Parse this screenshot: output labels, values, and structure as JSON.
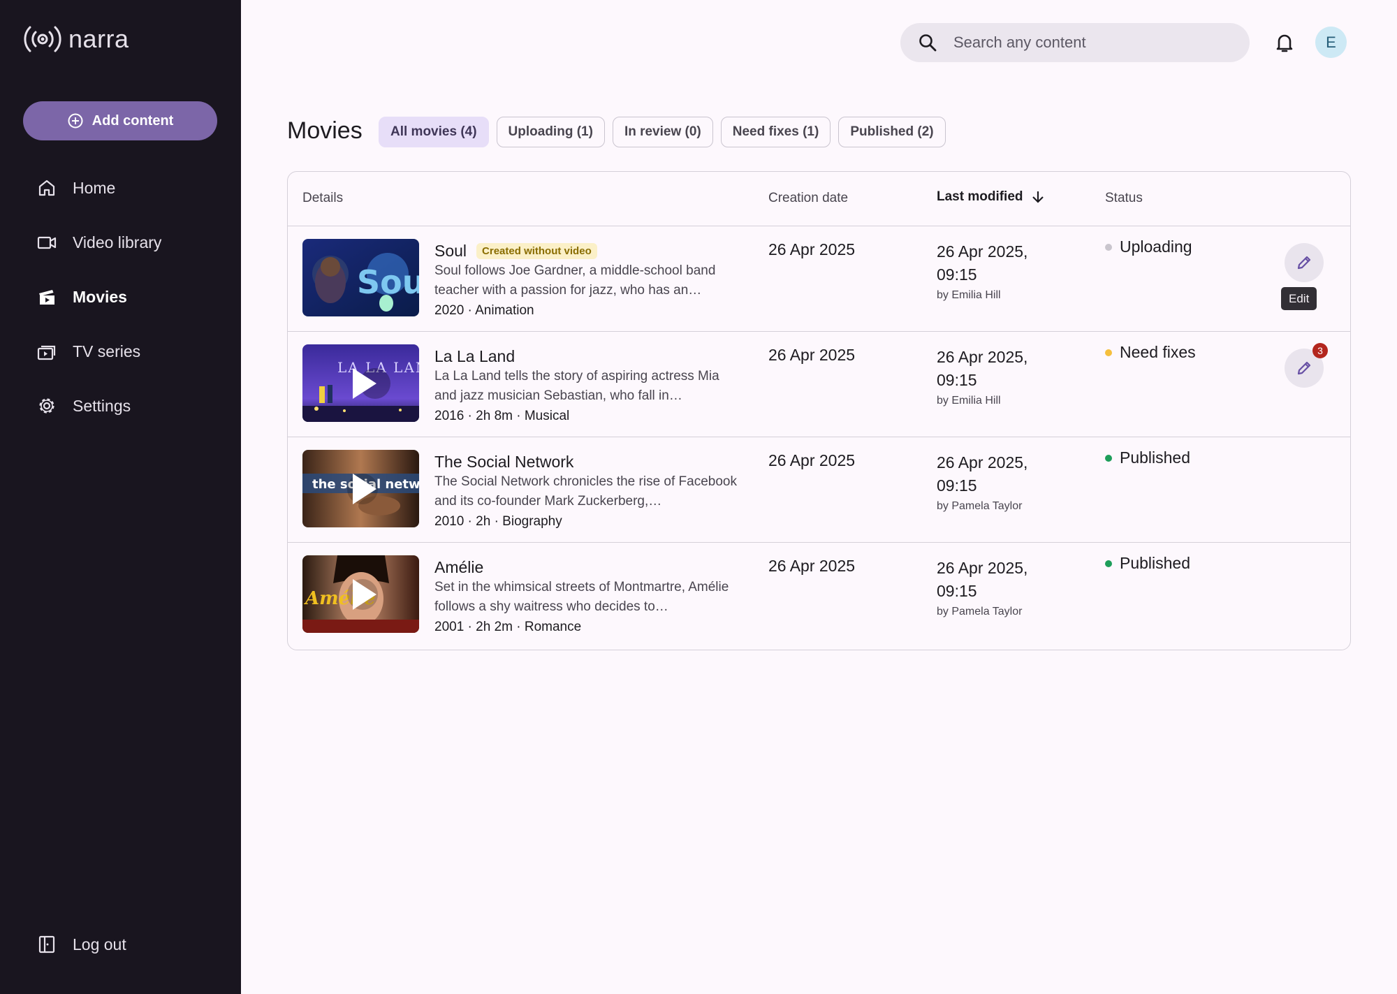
{
  "app": {
    "name": "narra"
  },
  "sidebar": {
    "add_button": "Add content",
    "items": [
      {
        "label": "Home",
        "icon": "home-icon"
      },
      {
        "label": "Video library",
        "icon": "video-camera-icon"
      },
      {
        "label": "Movies",
        "icon": "movie-clapper-icon",
        "active": true
      },
      {
        "label": "TV series",
        "icon": "tv-series-icon"
      },
      {
        "label": "Settings",
        "icon": "gear-icon"
      }
    ],
    "logout": "Log out"
  },
  "header": {
    "search_placeholder": "Search any content",
    "avatar_initial": "E"
  },
  "page": {
    "title": "Movies",
    "filters": [
      {
        "label": "All movies (4)",
        "active": true
      },
      {
        "label": "Uploading (1)"
      },
      {
        "label": "In review (0)"
      },
      {
        "label": "Need fixes (1)"
      },
      {
        "label": "Published (2)"
      }
    ]
  },
  "table": {
    "columns": {
      "details": "Details",
      "creation_date": "Creation date",
      "last_modified": "Last modified",
      "status": "Status"
    },
    "rows": [
      {
        "title": "Soul",
        "tag": "Created without video",
        "description": "Soul follows Joe Gardner, a middle-school band teacher with a passion for jazz, who has an…",
        "meta": "2020 · Animation",
        "creation_date": "26 Apr 2025",
        "modified_date": "26 Apr 2025,",
        "modified_time": "09:15",
        "modified_by": "by Emilia Hill",
        "status": "Uploading",
        "status_color": "#c9c5cd",
        "edit_tooltip": "Edit"
      },
      {
        "title": "La La Land",
        "description": "La La Land tells the story of aspiring actress Mia and jazz musician Sebastian, who fall in…",
        "meta": "2016 · 2h 8m · Musical",
        "creation_date": "26 Apr 2025",
        "modified_date": "26 Apr 2025,",
        "modified_time": "09:15",
        "modified_by": "by Emilia Hill",
        "status": "Need fixes",
        "status_color": "#f5bf3d",
        "edit_badge": "3"
      },
      {
        "title": "The Social Network",
        "description": "The Social Network chronicles the rise of Facebook and its co-founder Mark Zuckerberg,…",
        "meta": "2010 · 2h · Biography",
        "creation_date": "26 Apr 2025",
        "modified_date": "26 Apr 2025,",
        "modified_time": "09:15",
        "modified_by": "by Pamela Taylor",
        "status": "Published",
        "status_color": "#1e9e5a"
      },
      {
        "title": "Amélie",
        "description": "Set in the whimsical streets of Montmartre, Amélie follows a shy waitress who decides to…",
        "meta": "2001 · 2h 2m · Romance",
        "creation_date": "26 Apr 2025",
        "modified_date": "26 Apr 2025,",
        "modified_time": "09:15",
        "modified_by": "by Pamela Taylor",
        "status": "Published",
        "status_color": "#1e9e5a"
      }
    ]
  }
}
